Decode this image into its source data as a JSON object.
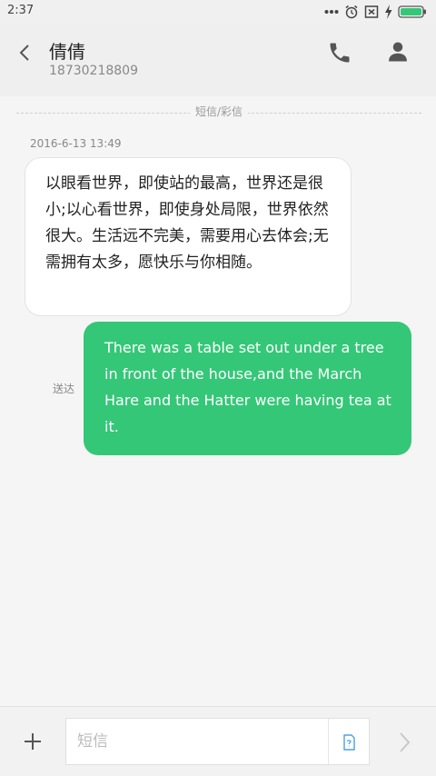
{
  "status_bar": {
    "time": "2:37",
    "icons": [
      "more-dots-icon",
      "alarm-icon",
      "no-sim-icon",
      "charging-icon",
      "battery-icon"
    ]
  },
  "header": {
    "contact_name": "倩倩",
    "contact_number": "18730218809",
    "icons": [
      "back-arrow-icon",
      "phone-icon",
      "person-icon"
    ]
  },
  "thread": {
    "channel_label": "短信/彩信",
    "messages": [
      {
        "direction": "incoming",
        "date": "2016-6-13 13:49",
        "text": "以眼看世界，即使站的最高，世界还是很小;以心看世界，即使身处局限，世界依然很大。生活远不完美，需要用心去体会;无需拥有太多，愿快乐与你相随。"
      },
      {
        "direction": "outgoing",
        "status": "送达",
        "text": "There was a table set out under a tree in front of the house,and the March Hare and the Hatter were having tea at it."
      }
    ]
  },
  "composer": {
    "placeholder": "短信",
    "value": "",
    "icons": [
      "plus-icon",
      "sim-card-icon",
      "send-arrow-icon"
    ]
  },
  "colors": {
    "outgoing_bubble": "#34c777",
    "incoming_bubble": "#ffffff",
    "battery": "#34c777",
    "background": "#f5f5f5"
  }
}
